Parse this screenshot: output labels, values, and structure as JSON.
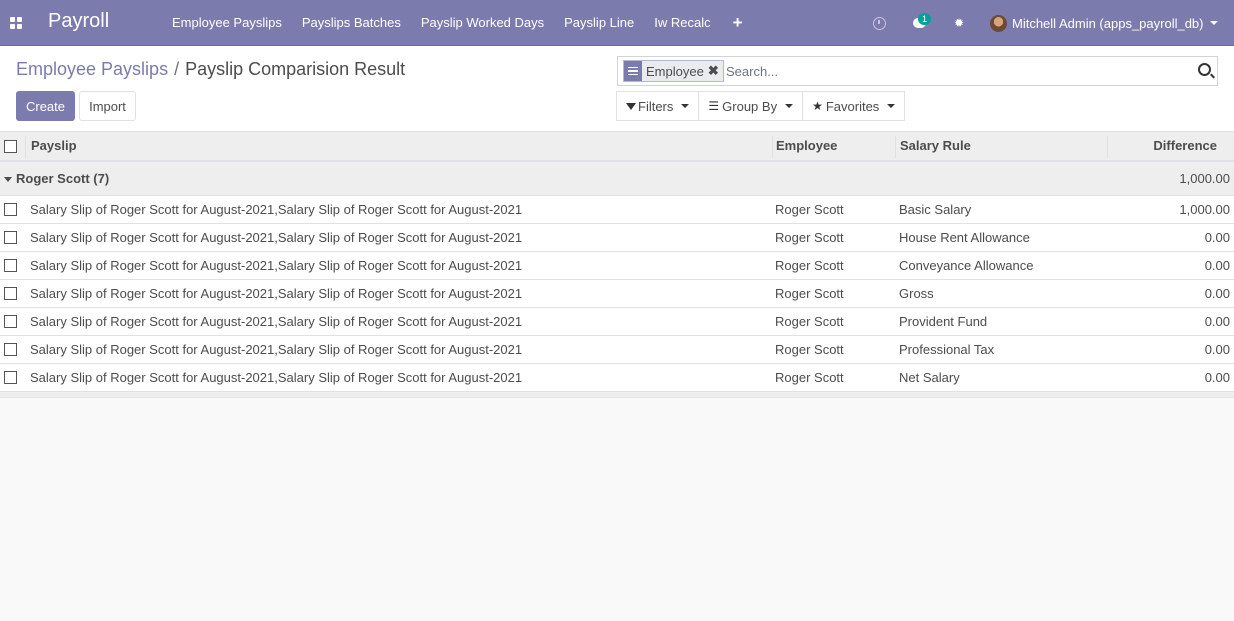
{
  "navbar": {
    "brand": "Payroll",
    "menu": [
      "Employee Payslips",
      "Payslips Batches",
      "Payslip Worked Days",
      "Payslip Line",
      "Iw Recalc"
    ],
    "plus": "+",
    "chat_badge": "1",
    "user": "Mitchell Admin (apps_payroll_db)",
    "icons": [
      "apps-icon",
      "clock-icon",
      "chat-icon",
      "bug-icon",
      "avatar"
    ]
  },
  "breadcrumb": {
    "parent": "Employee Payslips",
    "separator": "/",
    "current": "Payslip Comparision Result"
  },
  "buttons": {
    "create": "Create",
    "import": "Import"
  },
  "search": {
    "facet": "Employee",
    "placeholder": "Search..."
  },
  "filters": {
    "filters": "Filters",
    "group_by": "Group By",
    "favorites": "Favorites"
  },
  "table": {
    "headers": {
      "payslip": "Payslip",
      "employee": "Employee",
      "salary_rule": "Salary Rule",
      "difference": "Difference"
    },
    "group": {
      "label": "Roger Scott (7)",
      "total": "1,000.00"
    },
    "rows": [
      {
        "payslip": "Salary Slip of Roger Scott for August-2021,Salary Slip of Roger Scott for August-2021",
        "employee": "Roger Scott",
        "rule": "Basic Salary",
        "difference": "1,000.00"
      },
      {
        "payslip": "Salary Slip of Roger Scott for August-2021,Salary Slip of Roger Scott for August-2021",
        "employee": "Roger Scott",
        "rule": "House Rent Allowance",
        "difference": "0.00"
      },
      {
        "payslip": "Salary Slip of Roger Scott for August-2021,Salary Slip of Roger Scott for August-2021",
        "employee": "Roger Scott",
        "rule": "Conveyance Allowance",
        "difference": "0.00"
      },
      {
        "payslip": "Salary Slip of Roger Scott for August-2021,Salary Slip of Roger Scott for August-2021",
        "employee": "Roger Scott",
        "rule": "Gross",
        "difference": "0.00"
      },
      {
        "payslip": "Salary Slip of Roger Scott for August-2021,Salary Slip of Roger Scott for August-2021",
        "employee": "Roger Scott",
        "rule": "Provident Fund",
        "difference": "0.00"
      },
      {
        "payslip": "Salary Slip of Roger Scott for August-2021,Salary Slip of Roger Scott for August-2021",
        "employee": "Roger Scott",
        "rule": "Professional Tax",
        "difference": "0.00"
      },
      {
        "payslip": "Salary Slip of Roger Scott for August-2021,Salary Slip of Roger Scott for August-2021",
        "employee": "Roger Scott",
        "rule": "Net Salary",
        "difference": "0.00"
      }
    ]
  },
  "colors": {
    "navbar": "#7c7bad",
    "accent": "#7c7bad",
    "badge": "#00a09d"
  }
}
